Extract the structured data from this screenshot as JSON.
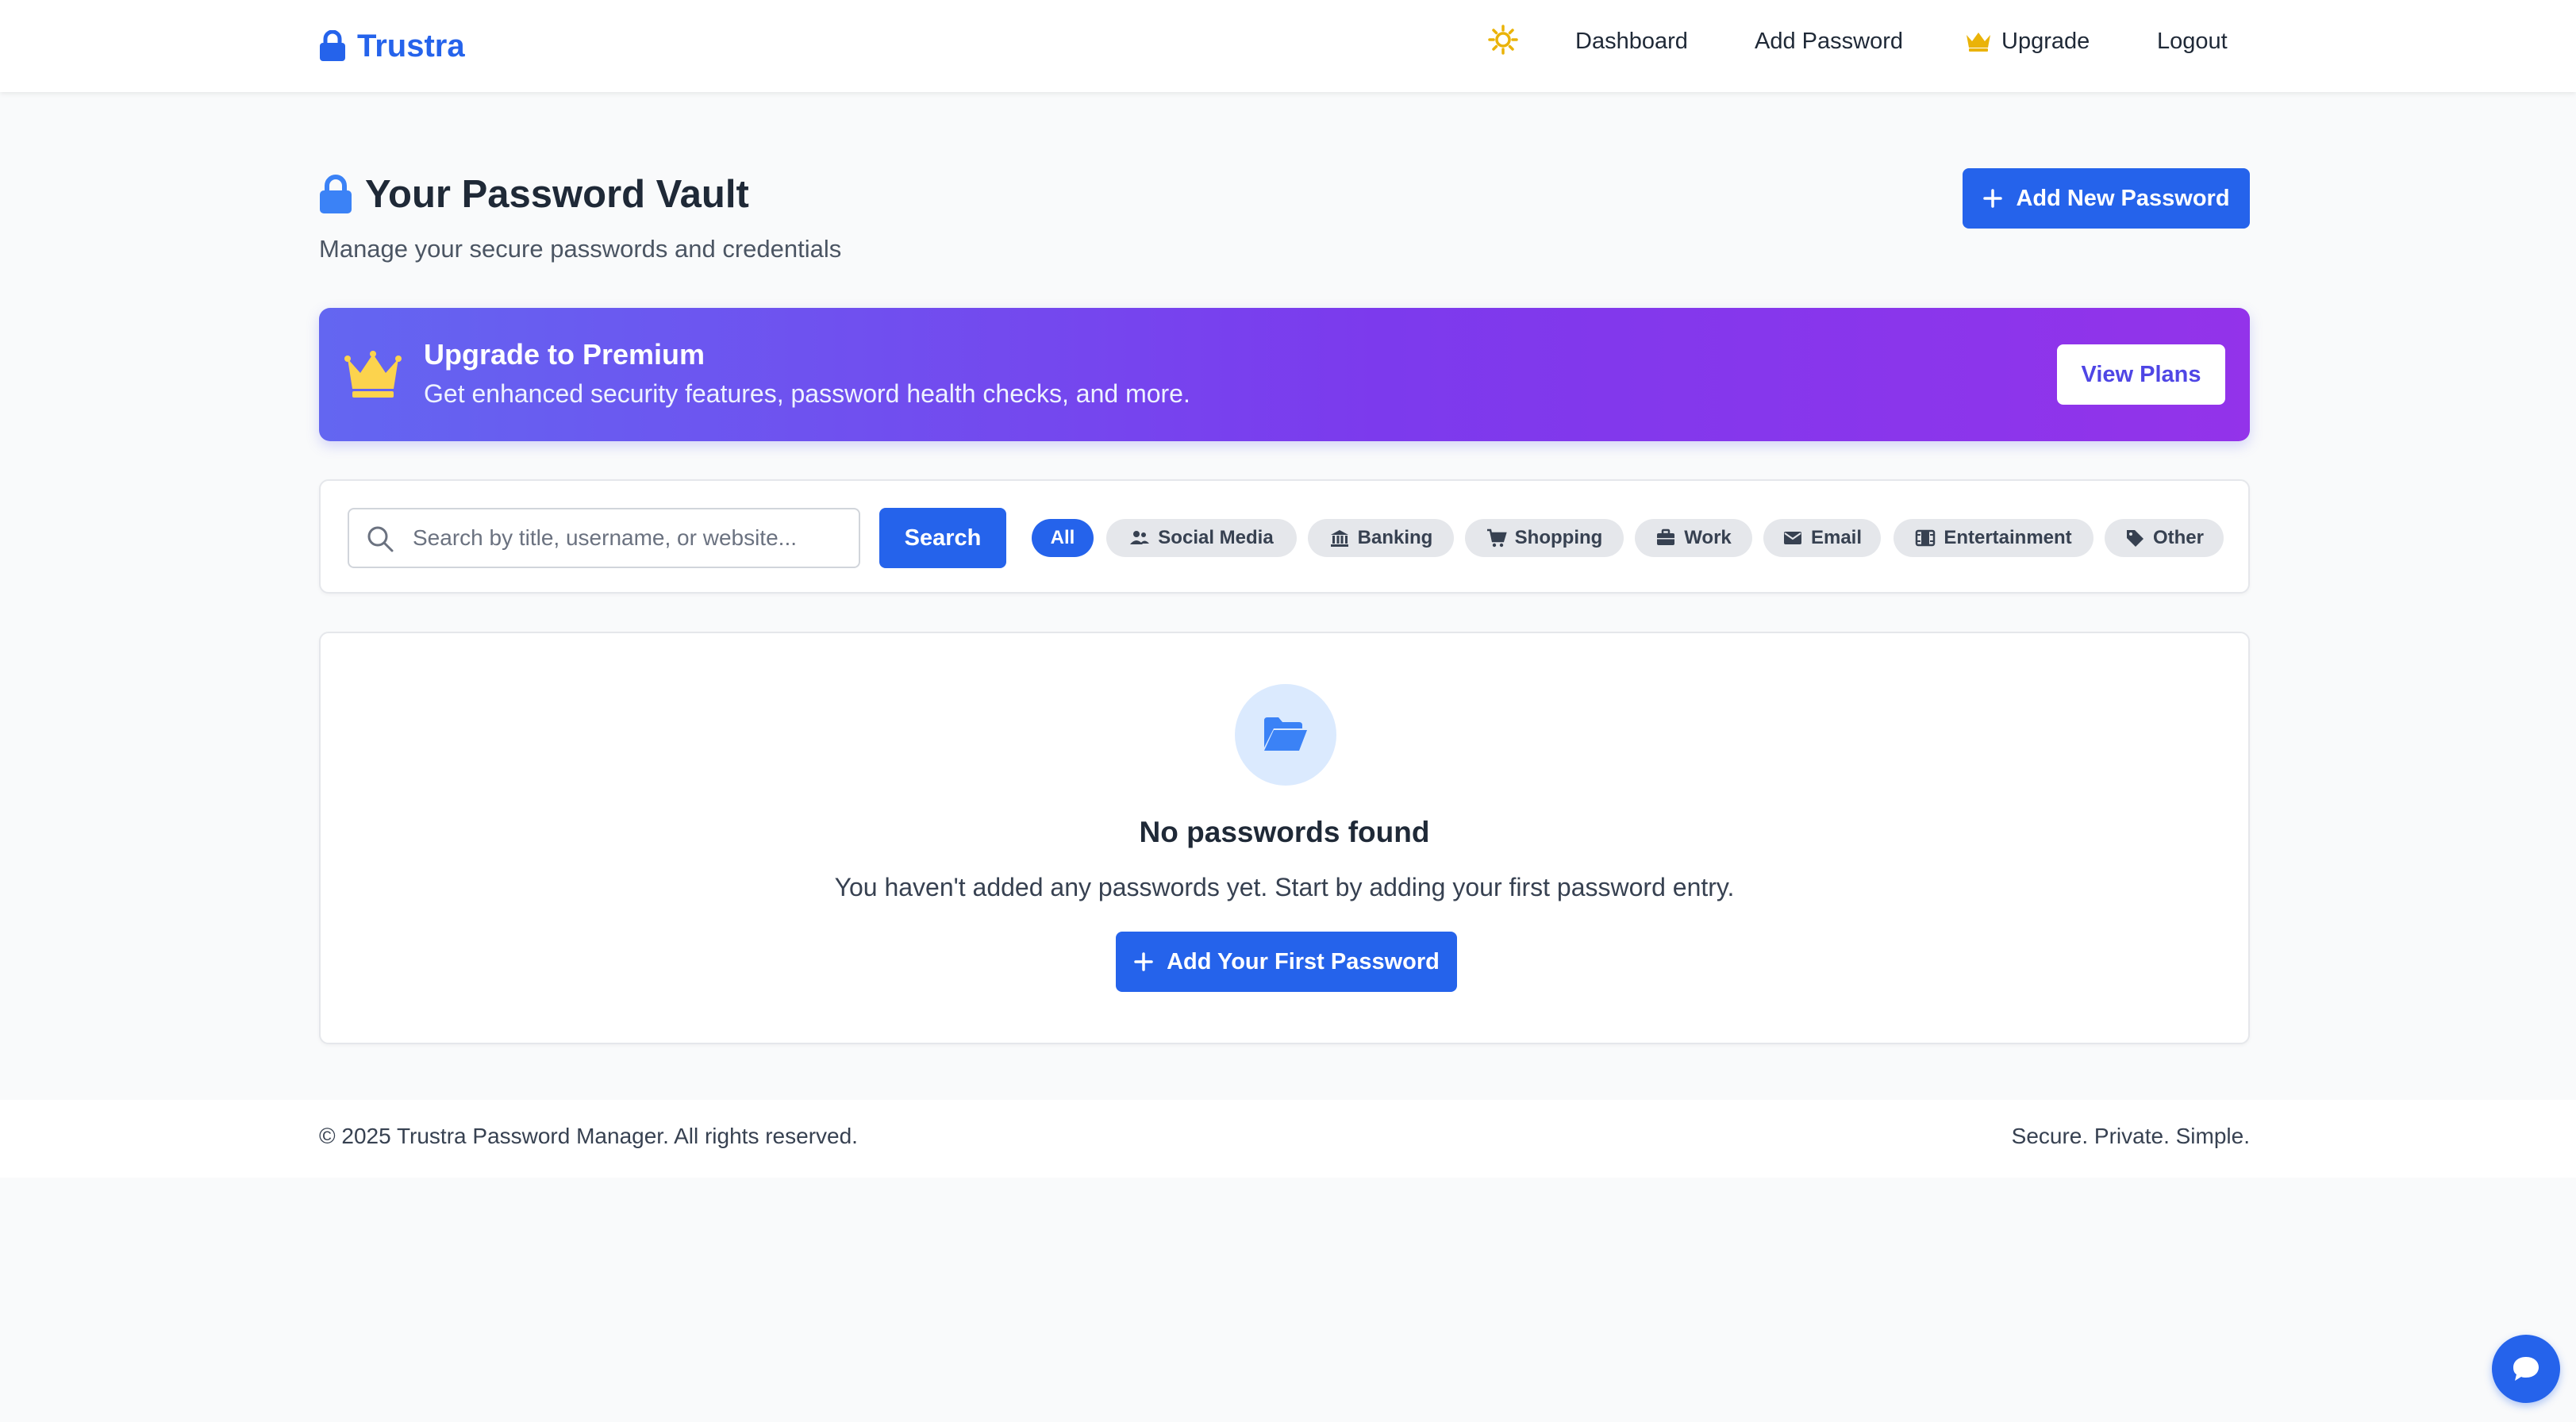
{
  "header": {
    "brand": "Trustra",
    "nav": {
      "dashboard": "Dashboard",
      "add_password": "Add Password",
      "upgrade": "Upgrade",
      "logout": "Logout"
    }
  },
  "page": {
    "title": "Your Password Vault",
    "subtitle": "Manage your secure passwords and credentials",
    "add_new_label": "Add New Password"
  },
  "banner": {
    "title": "Upgrade to Premium",
    "text": "Get enhanced security features, password health checks, and more.",
    "button": "View Plans"
  },
  "search": {
    "placeholder": "Search by title, username, or website...",
    "value": "",
    "button": "Search"
  },
  "categories": [
    {
      "label": "All",
      "icon": "none",
      "active": true
    },
    {
      "label": "Social Media",
      "icon": "users-icon",
      "active": false
    },
    {
      "label": "Banking",
      "icon": "bank-icon",
      "active": false
    },
    {
      "label": "Shopping",
      "icon": "cart-icon",
      "active": false
    },
    {
      "label": "Work",
      "icon": "briefcase-icon",
      "active": false
    },
    {
      "label": "Email",
      "icon": "envelope-icon",
      "active": false
    },
    {
      "label": "Entertainment",
      "icon": "film-icon",
      "active": false
    },
    {
      "label": "Other",
      "icon": "tag-icon",
      "active": false
    }
  ],
  "empty_state": {
    "title": "No passwords found",
    "text": "You haven't added any passwords yet. Start by adding your first password entry.",
    "button": "Add Your First Password"
  },
  "footer": {
    "copyright": "© 2025 Trustra Password Manager. All rights reserved.",
    "tagline": "Secure. Private. Simple."
  },
  "colors": {
    "primary": "#2563eb",
    "banner_start": "#6366f1",
    "banner_end": "#9333ea",
    "crown": "#fbbf24",
    "sun": "#eab308"
  }
}
